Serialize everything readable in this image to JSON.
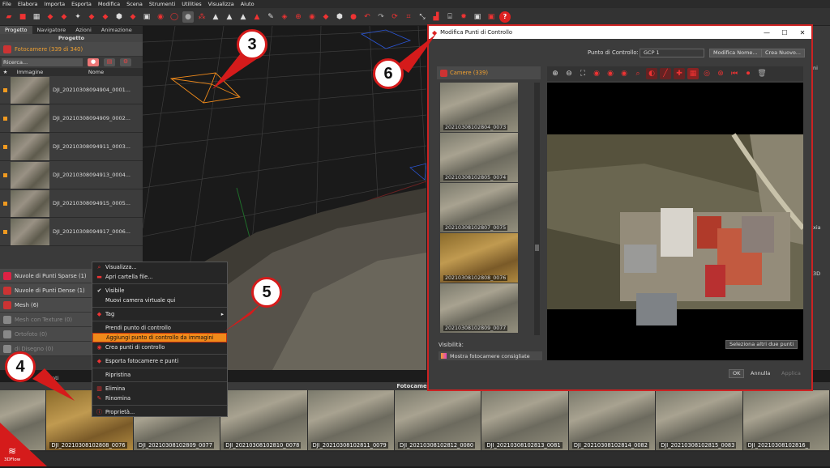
{
  "menubar": [
    "File",
    "Elabora",
    "Importa",
    "Esporta",
    "Modifica",
    "Scena",
    "Strumenti",
    "Utilities",
    "Visualizza",
    "Aiuto"
  ],
  "left_panel": {
    "tabs": [
      "Progetto",
      "Navigatore",
      "Azioni",
      "Animazione"
    ],
    "title": "Progetto",
    "cameras_header": "Fotocamere (339 di 340)",
    "search_placeholder": "Ricerca...",
    "col_image": "Immagine",
    "col_name": "Nome",
    "cameras": [
      "DJI_20210308094904_0001...",
      "DJI_20210308094909_0002...",
      "DJI_20210308094911_0003...",
      "DJI_20210308094913_0004...",
      "DJI_20210308094915_0005...",
      "DJI_20210308094917_0006..."
    ],
    "sections": [
      "Nuvole di Punti Sparse (1)",
      "Nuvole di Punti Dense (1)",
      "Mesh (6)",
      "Mesh con Texture (0)",
      "Ortofoto (0)",
      "di Disegno (0)"
    ],
    "bottom_label": "enti"
  },
  "context_menu": {
    "items": [
      {
        "label": "Visualizza...",
        "icon": "magnifier-icon"
      },
      {
        "label": "Apri cartella file...",
        "icon": "folder-icon"
      },
      {
        "sep": true
      },
      {
        "label": "Visibile",
        "icon": "check-icon"
      },
      {
        "label": "Muovi camera virtuale qui",
        "icon": ""
      },
      {
        "sep": true
      },
      {
        "label": "Tag",
        "icon": "tag-icon",
        "submenu": true
      },
      {
        "sep": true
      },
      {
        "label": "Prendi punto di controllo",
        "icon": ""
      },
      {
        "label": "Aggiungi punto di controllo da immagini",
        "icon": "",
        "highlight": true
      },
      {
        "label": "Crea punti di controllo",
        "icon": "target-icon"
      },
      {
        "sep": true
      },
      {
        "label": "Esporta fotocamere e punti",
        "icon": "export-icon"
      },
      {
        "sep": true
      },
      {
        "label": "Ripristina",
        "icon": ""
      },
      {
        "sep": true
      },
      {
        "label": "Elimina",
        "icon": "trash-icon"
      },
      {
        "label": "Rinomina",
        "icon": "rename-icon"
      },
      {
        "sep": true
      },
      {
        "label": "Proprietà...",
        "icon": "info-icon"
      }
    ]
  },
  "dialog": {
    "title": "Modifica Punti di Controllo",
    "control_point_label": "Punto di Controllo:",
    "control_point_value": "GCP 1",
    "edit_name_button": "Modifica Nome...",
    "create_new_button": "Crea Nuovo...",
    "cameras_label": "Camere (339)",
    "thumbs": [
      "20210308102804_0073",
      "20210308102805_0074",
      "20210308102807_0075",
      "20210308102808_0076",
      "20210308102809_0077"
    ],
    "selected_thumb": 3,
    "visibility_label": "Visibilità:",
    "visibility_option": "Mostra fotocamere consigliate",
    "select_two_button": "Seleziona altri due punti",
    "ok_button": "OK",
    "cancel_button": "Annulla",
    "apply_button": "Applica"
  },
  "bottom_strip": {
    "title": "Fotocamere",
    "thumbs": [
      "0075",
      "DJI_20210308102808_0076",
      "DJI_20210308102809_0077",
      "DJI_20210308102810_0078",
      "DJI_20210308102811_0079",
      "DJI_20210308102812_0080",
      "DJI_20210308102813_0081",
      "DJI_20210308102814_0082",
      "DJI_20210308102815_0083",
      "DJI_20210308102816_"
    ],
    "selected": 1
  },
  "right_panel": {
    "labels": [
      "ni",
      "xia",
      "3D"
    ]
  },
  "callouts": [
    "3",
    "4",
    "5",
    "6"
  ],
  "logo": "3DFlow",
  "colors": {
    "accent": "#f08a1a",
    "callout_red": "#d51b1b",
    "dialog_border": "#cc2222"
  }
}
